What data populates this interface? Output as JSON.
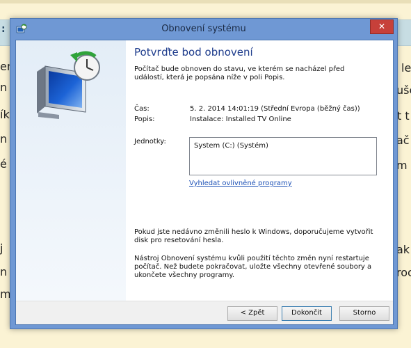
{
  "background": {
    "bar_text": ":",
    "left_fragments": [
      "en",
      "n",
      "ík",
      "n j",
      "é p",
      "j",
      "n",
      "m"
    ],
    "right_fragments": [
      "le",
      "uše",
      "t t",
      "ač",
      "m",
      "ak",
      "roc"
    ]
  },
  "window": {
    "title": "Obnovení systému",
    "close_glyph": "✕"
  },
  "content": {
    "heading": "Potvrďte bod obnovení",
    "description": "Počítač bude obnoven do stavu, ve kterém se nacházel před událostí, která je popsána níže v poli Popis.",
    "time_label": "Čas:",
    "time_value": "5. 2. 2014 14:01:19 (Střední Evropa (běžný čas))",
    "desc_label": "Popis:",
    "desc_value": "Instalace: Installed TV Online",
    "drives_label": "Jednotky:",
    "drives": [
      "System (C:) (Systém)"
    ],
    "affected_programs_link": "Vyhledat ovlivněné programy",
    "password_note": "Pokud jste nedávno změnili heslo k Windows, doporučujeme vytvořit disk pro resetování hesla.",
    "restart_note": "Nástroj Obnovení systému kvůli použití těchto změn nyní restartuje počítač. Než budete pokračovat, uložte všechny otevřené soubory a ukončete všechny programy."
  },
  "buttons": {
    "back": "< Zpět",
    "finish": "Dokončit",
    "cancel": "Storno"
  },
  "icons": {
    "title_icon": "system-restore-icon",
    "main_icon": "monitor-restore-clock-icon",
    "close": "close-icon"
  },
  "colors": {
    "window_frame": "#6f98d4",
    "close_button": "#c7403a",
    "heading": "#1e3c8c",
    "link": "#1a4fb5",
    "page_background": "#fbf3d4",
    "page_bar": "#c7dde3"
  }
}
